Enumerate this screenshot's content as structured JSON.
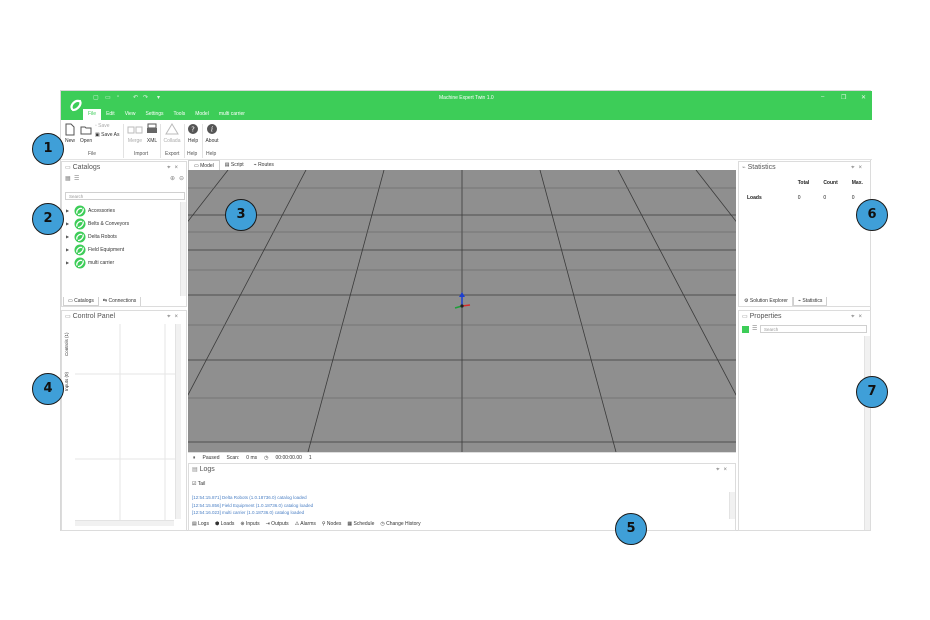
{
  "app": {
    "window_title": "Machine Expert Twin 1.0",
    "menu": [
      "File",
      "Edit",
      "View",
      "Settings",
      "Tools",
      "Model",
      "multi carrier"
    ],
    "active_menu": "File",
    "accent": "#3dcd58"
  },
  "ribbon": {
    "new": "New",
    "open": "Open",
    "save": "Save",
    "save_as": "Save As",
    "merge": "Merge",
    "xml": "XML",
    "collada": "Collada",
    "help": "Help",
    "about": "About",
    "groups": [
      "File",
      "Import",
      "Export",
      "Help",
      "Help"
    ]
  },
  "catalogs": {
    "title": "Catalogs",
    "search_placeholder": "Search",
    "items": [
      "Accessories",
      "Belts & Conveyors",
      "Delta Robots",
      "Field Equipment",
      "multi carrier"
    ],
    "tabs": [
      "Catalogs",
      "Connections"
    ]
  },
  "control_panel": {
    "title": "Control Panel",
    "side_tabs": [
      "Controls (1)",
      "Inputs (0)"
    ]
  },
  "document_tabs": [
    "Model",
    "Script",
    "Routes"
  ],
  "status": {
    "state": "Paused",
    "scan_label": "Scan:",
    "scan_value": "0 ms",
    "time": "00:00:00.00",
    "speed": "1"
  },
  "logs": {
    "title": "Logs",
    "tail_label": "Tail",
    "lines": [
      "[12:54:15.871] Delta Robots (1.0.18736.0) catalog loaded",
      "[12:54:15.856] Field Equipment (1.0.18736.0) catalog loaded",
      "[12:54:16.023] multi carrier (1.0.18736.0) catalog loaded"
    ],
    "tabs": [
      "Logs",
      "Loads",
      "Inputs",
      "Outputs",
      "Alarms",
      "Nodes",
      "Schedule",
      "Change History"
    ]
  },
  "statistics": {
    "title": "Statistics",
    "columns": [
      "Total",
      "Count",
      "Max."
    ],
    "row_label": "Loads",
    "row_values": [
      "0",
      "0",
      "0"
    ],
    "tabs": [
      "Solution Explorer",
      "Statistics"
    ]
  },
  "properties": {
    "title": "Properties",
    "search_placeholder": "Search"
  },
  "callouts": [
    "1",
    "2",
    "3",
    "4",
    "5",
    "6",
    "7"
  ]
}
